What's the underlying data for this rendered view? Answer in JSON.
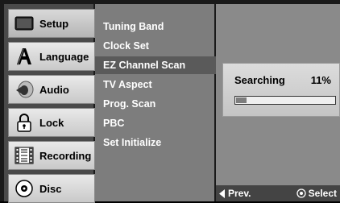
{
  "tabs": [
    {
      "label": "Setup",
      "icon": "monitor-icon",
      "active": true
    },
    {
      "label": "Language",
      "icon": "language-letter-icon",
      "active": false
    },
    {
      "label": "Audio",
      "icon": "speaker-icon",
      "active": false
    },
    {
      "label": "Lock",
      "icon": "padlock-icon",
      "active": false
    },
    {
      "label": "Recording",
      "icon": "film-icon",
      "active": false
    },
    {
      "label": "Disc",
      "icon": "disc-icon",
      "active": false
    }
  ],
  "menu": [
    {
      "label": "Tuning Band"
    },
    {
      "label": "Clock Set"
    },
    {
      "label": "EZ Channel Scan",
      "selected": true
    },
    {
      "label": "TV Aspect"
    },
    {
      "label": "Prog. Scan"
    },
    {
      "label": "PBC"
    },
    {
      "label": "Set Initialize"
    }
  ],
  "scan": {
    "status": "Searching",
    "percent": "11%",
    "progress": 0.11
  },
  "footer": {
    "prev_label": "Prev.",
    "select_label": "Select"
  },
  "colors": {
    "menu_bg": "#7d7d7d",
    "tab_bg": "#d0d0d0",
    "selected_bg": "#5a5a5a"
  }
}
